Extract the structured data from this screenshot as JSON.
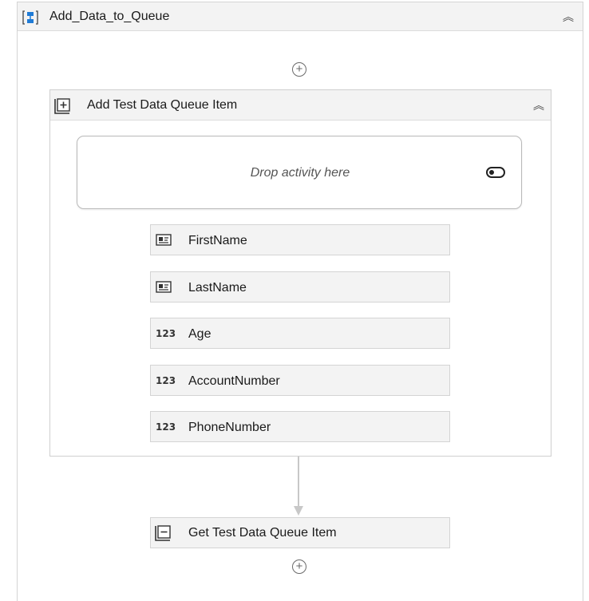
{
  "sequence": {
    "title": "Add_Data_to_Queue",
    "collapse_glyph": "︽",
    "icon": "sequence-icon"
  },
  "add_activity": {
    "title": "Add Test Data Queue Item",
    "collapse_glyph": "︽",
    "icon": "add-queue-item-icon",
    "drop_zone": {
      "placeholder": "Drop activity here",
      "toggle_icon": "toggle-icon"
    },
    "fields": [
      {
        "label": "FirstName",
        "icon": "text-argument-icon"
      },
      {
        "label": "LastName",
        "icon": "text-argument-icon"
      },
      {
        "label": "Age",
        "icon": "number-argument-icon",
        "glyph": "123"
      },
      {
        "label": "AccountNumber",
        "icon": "number-argument-icon",
        "glyph": "123"
      },
      {
        "label": "PhoneNumber",
        "icon": "number-argument-icon",
        "glyph": "123"
      }
    ]
  },
  "get_activity": {
    "title": "Get Test Data Queue Item",
    "icon": "get-queue-item-icon"
  },
  "add_glyph": "+",
  "colors": {
    "header_bg": "#f3f3f3",
    "border": "#d4d4d4",
    "icon_blue": "#1f7bd6",
    "connector": "#c8c8c8"
  }
}
